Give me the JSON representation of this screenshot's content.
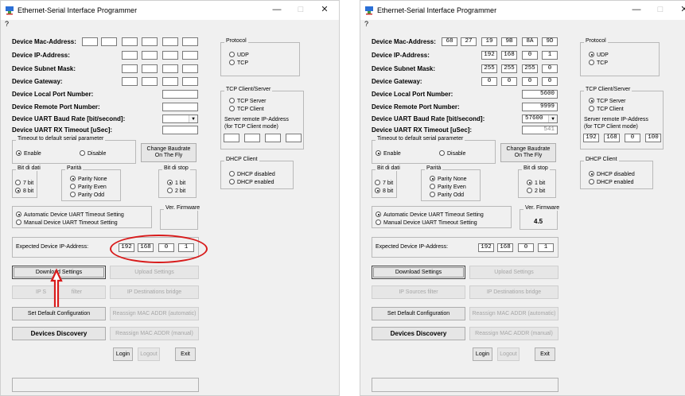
{
  "window": {
    "title": "Ethernet-Serial Interface Programmer",
    "menu": "?",
    "minimize": "—",
    "maximize": "□",
    "close": "✕"
  },
  "labels": {
    "mac": "Device Mac-Address:",
    "ip": "Device IP-Address:",
    "subnet": "Device Subnet Mask:",
    "gateway": "Device Gateway:",
    "local_port": "Device Local Port Number:",
    "remote_port": "Device Remote Port Number:",
    "baud": "Device UART Baud Rate [bit/second]:",
    "rx_timeout": "Device UART RX Timeout [uSec]:",
    "expected_ip": "Expected Device IP-Address:"
  },
  "groups": {
    "protocol": "Protocol",
    "udp": "UDP",
    "tcp": "TCP",
    "tcp_cs": "TCP Client/Server",
    "tcp_server": "TCP Server",
    "tcp_client": "TCP Client",
    "server_remote_ip_1": "Server remote IP-Address",
    "server_remote_ip_2": "(for TCP Client mode)",
    "dhcp": "DHCP Client",
    "dhcp_disabled": "DHCP disabled",
    "dhcp_enabled": "DHCP enabled",
    "timeout_default": "Timeout to default serial parameter",
    "enable": "Enable",
    "disable": "Disable",
    "databits": "Bit di dati",
    "bit7": "7 bit",
    "bit8": "8 bit",
    "parity": "Parità",
    "parity_none": "Parity None",
    "parity_even": "Parity Even",
    "parity_odd": "Parity Odd",
    "stopbits": "Bit di stop",
    "stop1": "1 bit",
    "stop2": "2 bit",
    "auto_timeout": "Automatic Device UART Timeout Setting",
    "manual_timeout": "Manual Device UART Timeout Setting",
    "firmware": "Ver. Firmware"
  },
  "buttons": {
    "change_baud_1": "Change Baudrate",
    "change_baud_2": "On The Fly",
    "download": "Download Settings",
    "upload": "Upload Settings",
    "ip_sources": "IP Sources filter",
    "ip_sources_left": "IP S",
    "ip_sources_right": "filter",
    "ip_dest": "IP Destinations bridge",
    "set_default": "Set Default Configuration",
    "reassign_auto": "Reassign MAC ADDR (automatic)",
    "devices_discovery": "Devices Discovery",
    "reassign_manual": "Reassign MAC ADDR (manual)",
    "login": "Login",
    "logout": "Logout",
    "exit": "Exit"
  },
  "left": {
    "expected_ip": [
      "192",
      "168",
      "0",
      "1"
    ]
  },
  "right": {
    "mac": [
      "68",
      "27",
      "19",
      "9B",
      "8A",
      "9D"
    ],
    "ip": [
      "192",
      "168",
      "0",
      "1"
    ],
    "subnet": [
      "255",
      "255",
      "255",
      "0"
    ],
    "gateway": [
      "0",
      "0",
      "0",
      "0"
    ],
    "local_port": "5600",
    "remote_port": "9999",
    "baud": "57600",
    "rx_timeout": "541",
    "server_ip": [
      "192",
      "168",
      "0",
      "100"
    ],
    "firmware": "4.5",
    "expected_ip": [
      "192",
      "168",
      "0",
      "1"
    ]
  },
  "colors": {
    "annotation": "#d81b1b"
  }
}
